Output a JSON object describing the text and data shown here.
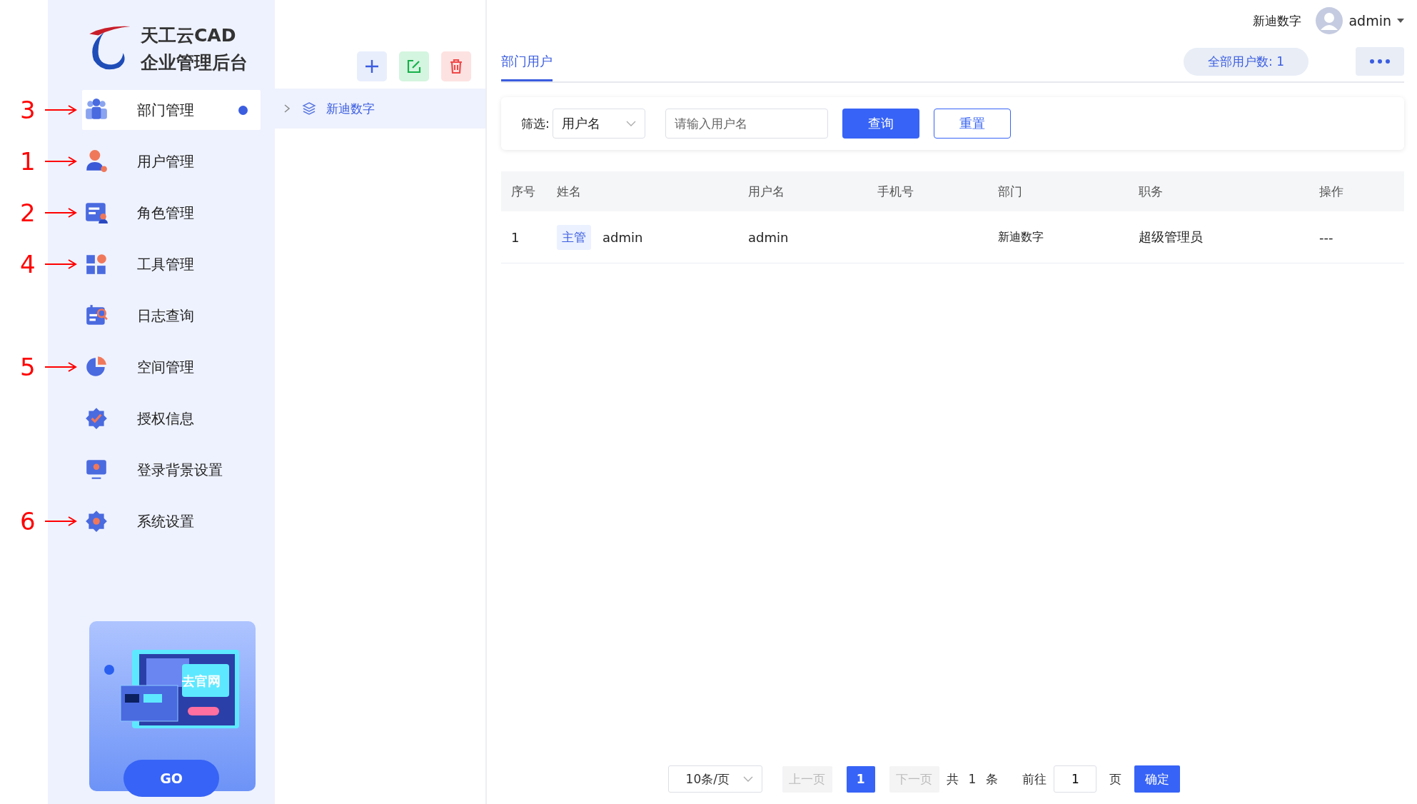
{
  "sidebar": {
    "logo": {
      "line1": "天工云CAD",
      "line2": "企业管理后台"
    },
    "items": [
      {
        "label": "部门管理",
        "selected": true,
        "annotation": "3"
      },
      {
        "label": "用户管理",
        "selected": false,
        "annotation": "1"
      },
      {
        "label": "角色管理",
        "selected": false,
        "annotation": "2"
      },
      {
        "label": "工具管理",
        "selected": false,
        "annotation": "4"
      },
      {
        "label": "日志查询",
        "selected": false
      },
      {
        "label": "空间管理",
        "selected": false,
        "annotation": "5"
      },
      {
        "label": "授权信息",
        "selected": false
      },
      {
        "label": "登录背景设置",
        "selected": false
      },
      {
        "label": "系统设置",
        "selected": false,
        "annotation": "6"
      }
    ],
    "promo": {
      "screen_text": "去官网",
      "button": "GO"
    }
  },
  "tree": {
    "toolbar": [
      {
        "kind": "add"
      },
      {
        "kind": "edit"
      },
      {
        "kind": "delete"
      }
    ],
    "nodes": [
      {
        "label": "新迪数字",
        "expanded": false,
        "selected": true
      }
    ]
  },
  "header": {
    "org": "新迪数字",
    "user": "admin"
  },
  "tabs": [
    {
      "label": "部门用户",
      "selected": true
    }
  ],
  "total": "全部用户数: 1",
  "filter": {
    "label": "筛选:",
    "field": "用户名",
    "placeholder": "请输入用户名",
    "query": "查询",
    "reset": "重置"
  },
  "table": {
    "columns": [
      "序号",
      "姓名",
      "用户名",
      "手机号",
      "部门",
      "职务",
      "操作"
    ],
    "rows": [
      {
        "index": "1",
        "tag": "主管",
        "name": "admin",
        "username": "admin",
        "dept": "新迪数字",
        "position": "超级管理员",
        "action": "---"
      }
    ]
  },
  "pagination": {
    "page_size": "10条/页",
    "prev": {
      "label": "上一页",
      "disabled": true
    },
    "pages": [
      {
        "label": "1",
        "selected": true
      }
    ],
    "next": {
      "label": "下一页",
      "disabled": true
    },
    "total_prefix": "共",
    "total": "1",
    "total_suffix": "条",
    "goto": "前往",
    "goto_value": "1",
    "page_unit": "页",
    "confirm": "确定"
  }
}
